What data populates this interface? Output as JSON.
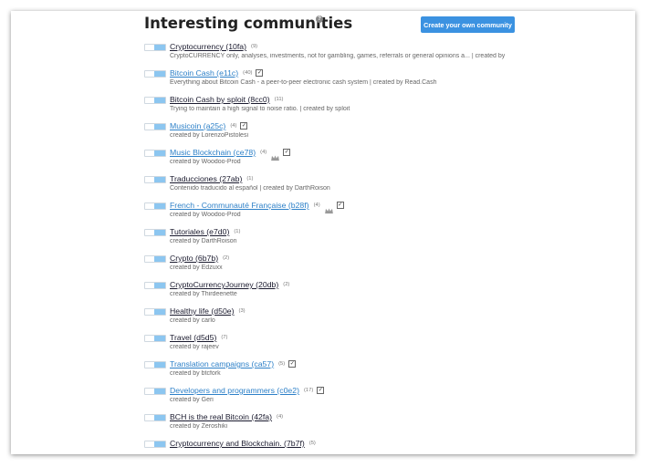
{
  "page": {
    "title": "Interesting communities",
    "help_icon": "?",
    "create_button": "Create your own community"
  },
  "colors": {
    "button_bg": "#3b92e1",
    "link_blue": "#2d80c8",
    "link_dark": "#1a1a2e",
    "toggle_knob": "#8cc6f0"
  },
  "communities": [
    {
      "name": "Cryptocurrency (10fa)",
      "count": "(9)",
      "desc": "CryptoCURRENCY only, analyses, investments, not for gambling, games, referrals or general opinions a... | created by",
      "style": "dark",
      "crown": false,
      "checked": false
    },
    {
      "name": "Bitcoin Cash (e11c)",
      "count": "(40)",
      "desc": "Everything about Bitcoin Cash - a peer-to-peer electronic cash system | created by Read.Cash",
      "style": "blue",
      "crown": false,
      "checked": true
    },
    {
      "name": "Bitcoin Cash by sploit (8cc0)",
      "count": "(11)",
      "desc": "Trying to maintain a high signal to noise ratio. | created by sploit",
      "style": "dark",
      "crown": false,
      "checked": false
    },
    {
      "name": "Musicoin (a25c)",
      "count": "(4)",
      "desc": "created by LorenzoPistolesi",
      "style": "blue",
      "crown": false,
      "checked": true
    },
    {
      "name": "Music Blockchain (ce78)",
      "count": "(4)",
      "desc": "created by Woodoo-Prod",
      "style": "blue",
      "crown": true,
      "checked": true
    },
    {
      "name": "Traducciones (27ab)",
      "count": "(1)",
      "desc": "Contenido traducido al español | created by DarthRoison",
      "style": "dark",
      "crown": false,
      "checked": false
    },
    {
      "name": "French - Communauté Française (b28f)",
      "count": "(4)",
      "desc": "created by Woodoo-Prod",
      "style": "blue",
      "crown": true,
      "checked": true
    },
    {
      "name": "Tutoriales (e7d0)",
      "count": "(1)",
      "desc": "created by DarthRoison",
      "style": "dark",
      "crown": false,
      "checked": false
    },
    {
      "name": "Crypto (6b7b)",
      "count": "(2)",
      "desc": "created by Edzuxx",
      "style": "dark",
      "crown": false,
      "checked": false
    },
    {
      "name": "CryptoCurrencyJourney (20db)",
      "count": "(2)",
      "desc": "created by Thirdeenette",
      "style": "dark",
      "crown": false,
      "checked": false
    },
    {
      "name": "Healthy life (d50e)",
      "count": "(3)",
      "desc": "created by carlo",
      "style": "dark",
      "crown": false,
      "checked": false
    },
    {
      "name": "Travel (d5d5)",
      "count": "(7)",
      "desc": "created by rajeev",
      "style": "dark",
      "crown": false,
      "checked": false
    },
    {
      "name": "Translation campaigns (ca57)",
      "count": "(5)",
      "desc": "created by btcfork",
      "style": "blue",
      "crown": false,
      "checked": true
    },
    {
      "name": "Developers and programmers (c0e2)",
      "count": "(17)",
      "desc": "created by Geri",
      "style": "blue",
      "crown": false,
      "checked": true
    },
    {
      "name": "BCH is the real Bitcoin (42fa)",
      "count": "(4)",
      "desc": "created by Zeroshiki",
      "style": "dark",
      "crown": false,
      "checked": false
    },
    {
      "name": "Cryptocurrency and Blockchain. (7b7f)",
      "count": "(5)",
      "desc": "",
      "style": "dark",
      "crown": false,
      "checked": false
    }
  ]
}
